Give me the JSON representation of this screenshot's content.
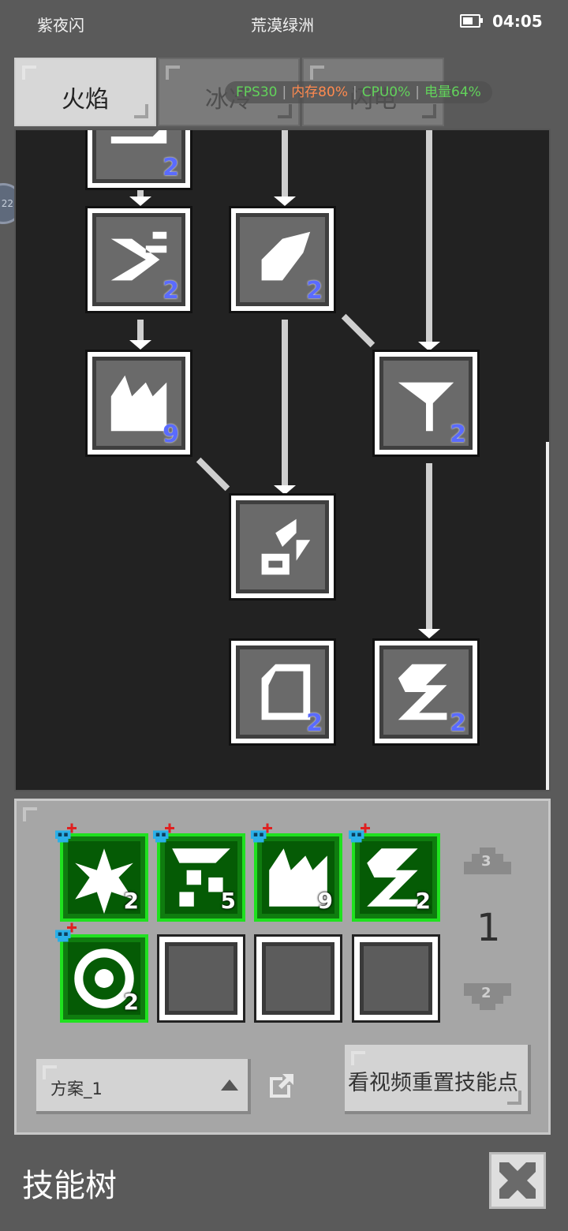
{
  "status_bar": {
    "left_text": "紫夜闪",
    "center_text": "荒漠绿洲",
    "time": "04:05",
    "battery_level": 0.64
  },
  "tabs": [
    {
      "label": "火焰",
      "active": true
    },
    {
      "label": "冰冷",
      "active": false
    },
    {
      "label": "闪电",
      "active": false
    }
  ],
  "overlay": {
    "fps": "FPS30",
    "mem": "内存80%",
    "cpu": "CPU0%",
    "battery": "电量64%"
  },
  "side_badge": "22",
  "tree": {
    "nodes": [
      {
        "id": "n0",
        "level": "2"
      },
      {
        "id": "n1",
        "level": "2"
      },
      {
        "id": "n2",
        "level": "2"
      },
      {
        "id": "n3",
        "level": "9"
      },
      {
        "id": "n4",
        "level": "2"
      },
      {
        "id": "n5",
        "level": ""
      },
      {
        "id": "n6",
        "level": "2"
      },
      {
        "id": "n7",
        "level": "2"
      }
    ]
  },
  "loadout": {
    "slots": [
      {
        "count": "2",
        "equipped": true
      },
      {
        "count": "5",
        "equipped": true
      },
      {
        "count": "9",
        "equipped": true
      },
      {
        "count": "2",
        "equipped": true
      },
      {
        "count": "2",
        "equipped": true
      },
      {
        "count": "",
        "equipped": false
      },
      {
        "count": "",
        "equipped": false
      },
      {
        "count": "",
        "equipped": false
      }
    ],
    "page_up": "3",
    "current_page": "1",
    "page_down": "2"
  },
  "preset": {
    "value": "方案_1"
  },
  "reset_button": "看视频重置技能点",
  "page_title": "技能树",
  "colors": {
    "accent_green": "#1fe11f",
    "level_blue": "#5a6bff",
    "fps_green": "#62d35b",
    "mem_orange": "#ff8a4f"
  }
}
